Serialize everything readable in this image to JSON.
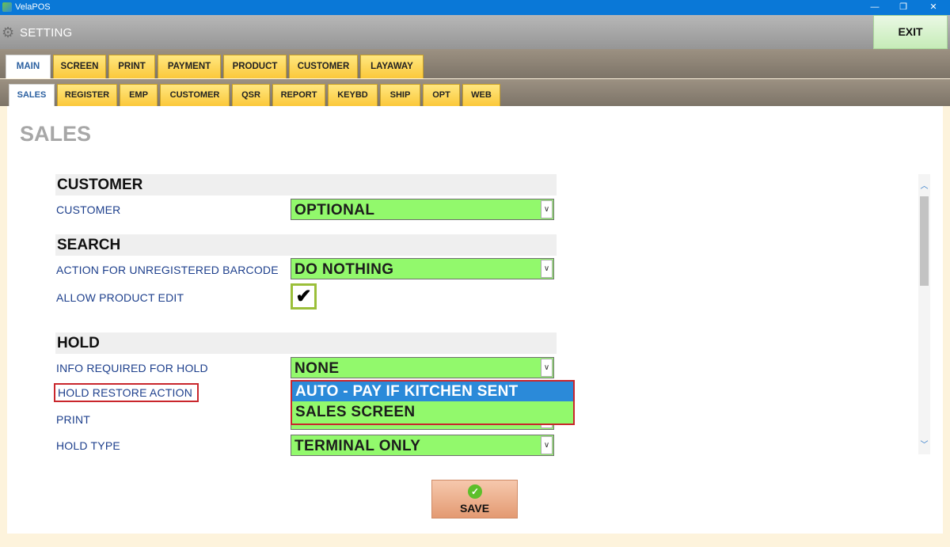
{
  "window": {
    "title": "VelaPOS",
    "minimize": "—",
    "restore": "❐",
    "close": "✕"
  },
  "header": {
    "title": "SETTING",
    "exit_label": "EXIT"
  },
  "main_tabs": [
    {
      "label": "MAIN",
      "active": true
    },
    {
      "label": "SCREEN",
      "active": false
    },
    {
      "label": "PRINT",
      "active": false
    },
    {
      "label": "PAYMENT",
      "active": false
    },
    {
      "label": "PRODUCT",
      "active": false
    },
    {
      "label": "CUSTOMER",
      "active": false
    },
    {
      "label": "LAYAWAY",
      "active": false
    }
  ],
  "sub_tabs": [
    {
      "label": "SALES",
      "active": true
    },
    {
      "label": "REGISTER",
      "active": false
    },
    {
      "label": "EMP",
      "active": false
    },
    {
      "label": "CUSTOMER",
      "active": false
    },
    {
      "label": "QSR",
      "active": false
    },
    {
      "label": "REPORT",
      "active": false
    },
    {
      "label": "KEYBD",
      "active": false
    },
    {
      "label": "SHIP",
      "active": false
    },
    {
      "label": "OPT",
      "active": false
    },
    {
      "label": "WEB",
      "active": false
    }
  ],
  "page": {
    "title": "SALES"
  },
  "sections": {
    "customer": {
      "title": "CUSTOMER",
      "customer_label": "CUSTOMER",
      "customer_value": "OPTIONAL"
    },
    "search": {
      "title": "SEARCH",
      "unregistered_label": "ACTION FOR UNREGISTERED BARCODE",
      "unregistered_value": "DO NOTHING",
      "allow_edit_label": "ALLOW PRODUCT EDIT",
      "allow_edit_checked": true,
      "check_glyph": "✔"
    },
    "hold": {
      "title": "HOLD",
      "info_label": "INFO REQUIRED FOR HOLD",
      "info_value": "NONE",
      "restore_label": "HOLD RESTORE ACTION",
      "restore_options": [
        "AUTO - PAY IF KITCHEN SENT",
        "SALES SCREEN"
      ],
      "restore_highlighted": "AUTO - PAY IF KITCHEN SENT",
      "print_label": "PRINT",
      "hold_type_label": "HOLD TYPE",
      "hold_type_value": "TERMINAL ONLY"
    }
  },
  "scroll": {
    "up": "︿",
    "down": "﹀"
  },
  "save_label": "SAVE",
  "colors": {
    "field_green": "#92f96c",
    "highlight_blue": "#2b8ad9",
    "tab_yellow": "#fbc83a",
    "callout_red": "#c9262c"
  }
}
